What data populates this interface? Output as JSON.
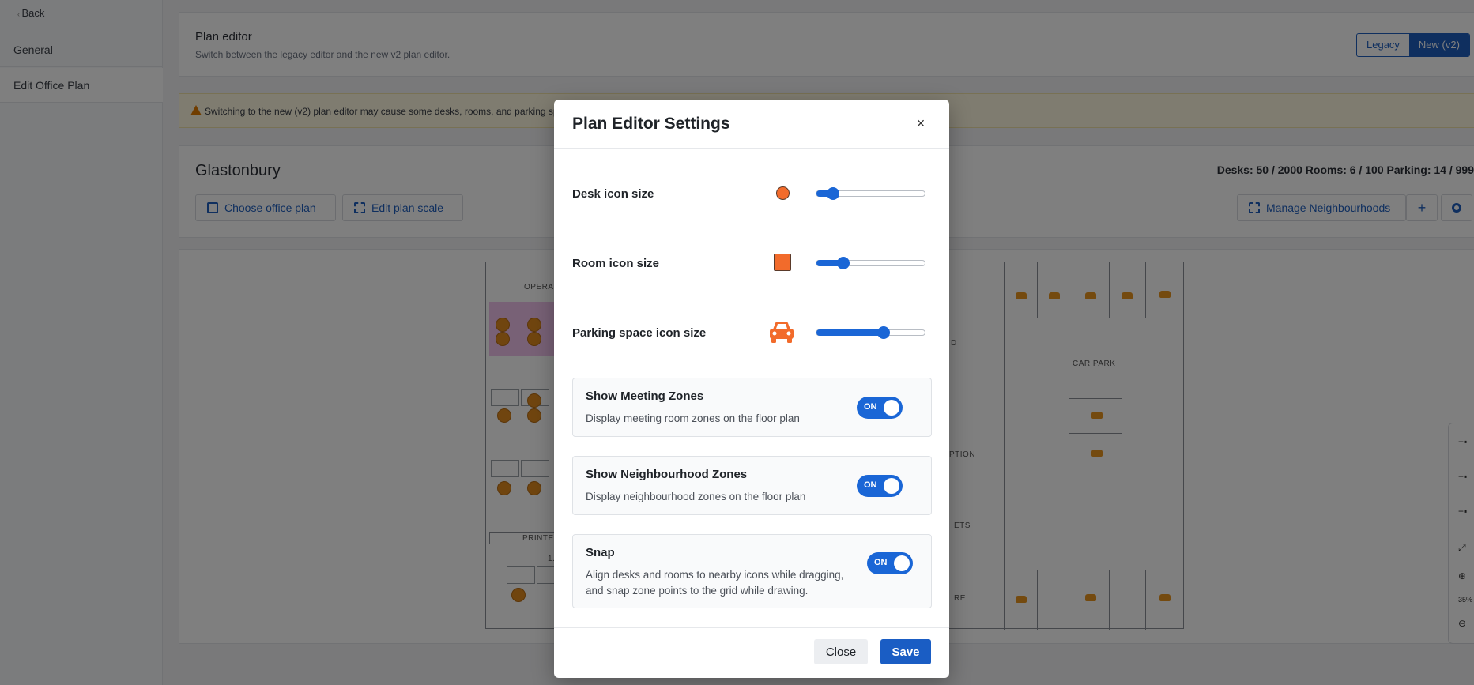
{
  "sidebar": {
    "back_label": "Back",
    "items": [
      {
        "label": "General"
      },
      {
        "label": "Edit Office Plan"
      }
    ]
  },
  "plan_editor": {
    "title": "Plan editor",
    "subtitle": "Switch between the legacy editor and the new v2 plan editor.",
    "options": [
      "Legacy",
      "New (v2)"
    ],
    "selected": "New (v2)"
  },
  "warning": {
    "text": "Switching to the new (v2) plan editor may cause some desks, rooms, and parking sp"
  },
  "office": {
    "name": "Glastonbury",
    "counts": "Desks: 50 / 2000  Rooms: 6 / 100  Parking: 14 / 999",
    "choose_plan_label": "Choose office plan",
    "edit_scale_label": "Edit plan scale",
    "manage_neighbourhoods_label": "Manage Neighbourhoods",
    "add_label": "+"
  },
  "floor_plan": {
    "labels": {
      "operations": "OPERAT",
      "printer": "PRINTER",
      "car_park": "CAR PARK",
      "reception": "PTION",
      "toilets": "ETS",
      "store": "RE",
      "room_code": "1.1",
      "small_mark": "D"
    }
  },
  "toolbar": {
    "zoom_level": "35%"
  },
  "modal": {
    "title": "Plan Editor Settings",
    "close_glyph": "×",
    "sliders": [
      {
        "label": "Desk icon size",
        "value": 0.15,
        "color": "#f26b2b"
      },
      {
        "label": "Room icon size",
        "value": 0.25,
        "color": "#f26b2b"
      },
      {
        "label": "Parking space icon size",
        "value": 0.62,
        "color": "#f26b2b"
      }
    ],
    "toggles": [
      {
        "title": "Show Meeting Zones",
        "description": "Display meeting room zones on the floor plan",
        "state": "ON"
      },
      {
        "title": "Show Neighbourhood Zones",
        "description": "Display neighbourhood zones on the floor plan",
        "state": "ON"
      },
      {
        "title": "Snap",
        "description": "Align desks and rooms to nearby icons while dragging, and snap zone points to the grid while drawing.",
        "state": "ON"
      }
    ],
    "close_label": "Close",
    "save_label": "Save"
  },
  "colors": {
    "accent": "#1a66d6",
    "icon": "#f26b2b",
    "desk": "#e08a1e"
  }
}
